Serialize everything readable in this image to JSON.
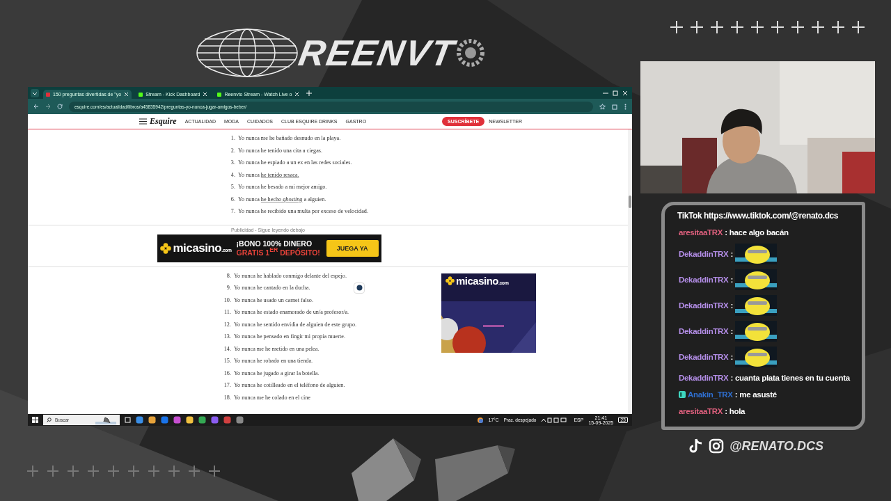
{
  "logo": {
    "text": "REENVT"
  },
  "browser": {
    "tabs": [
      {
        "label": "150 preguntas divertidas de \"yo",
        "selected": true,
        "color": "#e0303a"
      },
      {
        "label": "Stream - Kick Dashboard",
        "selected": false,
        "color": "#53fc18"
      },
      {
        "label": "Reenvto Stream - Watch Live o",
        "selected": false,
        "color": "#53fc18"
      }
    ],
    "address": "esquire.com/es/actualidad/libros/a45835942/preguntas-yo-nunca-jugar-amigos-beber/",
    "site": {
      "logo": "Esquire",
      "nav": [
        "ACTUALIDAD",
        "MODA",
        "CUIDADOS",
        "CLUB ESQUIRE DRINKS",
        "GASTRO"
      ],
      "subscribe": "SUSCRÍBETE",
      "newsletter": "NEWSLETTER"
    },
    "list_top": [
      {
        "number": "1.",
        "text": "Yo nunca me he bañado desnudo en la playa."
      },
      {
        "number": "2.",
        "text": "Yo nunca he tenido una cita a ciegas."
      },
      {
        "number": "3.",
        "text": "Yo nunca he espiado a un ex en las redes sociales."
      },
      {
        "number": "4.",
        "text": "Yo nunca ",
        "link": "he tenido resaca."
      },
      {
        "number": "5.",
        "text": "Yo nunca he besado a mi mejor amigo."
      },
      {
        "number": "6.",
        "text": "Yo nunca ",
        "link": "he hecho *ghosting*",
        "after": " a alguien."
      },
      {
        "number": "7.",
        "text": "Yo nunca he recibido una multa por exceso de velocidad."
      }
    ],
    "ad_label": "Publicidad - Sigue leyendo debajo",
    "banner": {
      "brand": "micasino",
      "brand_suffix": ".com",
      "line1": "¡BONO 100% DINERO",
      "line2": "GRATIS 1$^{ER}$ DEPÓSITO!",
      "button": "JUEGA YA"
    },
    "list_bottom": [
      {
        "number": "8.",
        "text": "Yo nunca he hablado conmigo delante del espejo."
      },
      {
        "number": "9.",
        "text": "Yo nunca he cantado en la ducha."
      },
      {
        "number": "10.",
        "text": "Yo nunca he usado un carnet falso."
      },
      {
        "number": "11.",
        "text": "Yo nunca he estado enamorado de un/a profesor/a."
      },
      {
        "number": "12.",
        "text": "Yo nunca he sentido envidia de alguien de este grupo."
      },
      {
        "number": "13.",
        "text": "Yo nunca he pensado en fingir mi propia muerte."
      },
      {
        "number": "14.",
        "text": "Yo nunca me he metido en una pelea."
      },
      {
        "number": "15.",
        "text": "Yo nunca he robado en una tienda."
      },
      {
        "number": "16.",
        "text": "Yo nunca he jugado a girar la botella."
      },
      {
        "number": "17.",
        "text": "Yo nunca he cotilleado en el teléfono de alguien."
      },
      {
        "number": "18.",
        "text": "Yo nunca me he colado en el cine"
      }
    ],
    "side_ad": {
      "brand": "micasino",
      "brand_suffix": ".com"
    }
  },
  "taskbar": {
    "search_placeholder": "Buscar",
    "temperature": "17°C",
    "weather": "Prac. despejado",
    "language": "ESP",
    "time": "21:41",
    "date": "15-09-2025",
    "notifications": "23"
  },
  "chat": {
    "header": "TikTok https://www.tiktok.com/@renato.dcs",
    "messages": [
      {
        "user": "aresitaaTRX",
        "color": "#e0607e",
        "separator": ":",
        "kind": "text",
        "text": "hace algo bacán",
        "badge": false
      },
      {
        "user": "DekaddinTRX",
        "color": "#b48ee8",
        "separator": ":",
        "kind": "emote",
        "badge": false
      },
      {
        "user": "DekaddinTRX",
        "color": "#b48ee8",
        "separator": ":",
        "kind": "emote",
        "badge": false
      },
      {
        "user": "DekaddinTRX",
        "color": "#b48ee8",
        "separator": ":",
        "kind": "emote",
        "badge": false
      },
      {
        "user": "DekaddinTRX",
        "color": "#b48ee8",
        "separator": ":",
        "kind": "emote",
        "badge": false
      },
      {
        "user": "DekaddinTRX",
        "color": "#b48ee8",
        "separator": ":",
        "kind": "emote",
        "badge": false
      },
      {
        "user": "DekaddinTRX",
        "color": "#b48ee8",
        "separator": ":",
        "kind": "text",
        "text": "cuanta plata tienes en tu cuenta",
        "badge": false
      },
      {
        "user": "Anakin_TRX",
        "color": "#2f6fd0",
        "separator": ":",
        "kind": "text",
        "text": "me asusté",
        "badge": true
      },
      {
        "user": "aresitaaTRX",
        "color": "#e0607e",
        "separator": ":",
        "kind": "text",
        "text": "hola",
        "badge": false
      }
    ]
  },
  "social": {
    "handle": "@RENATO.DCS"
  }
}
